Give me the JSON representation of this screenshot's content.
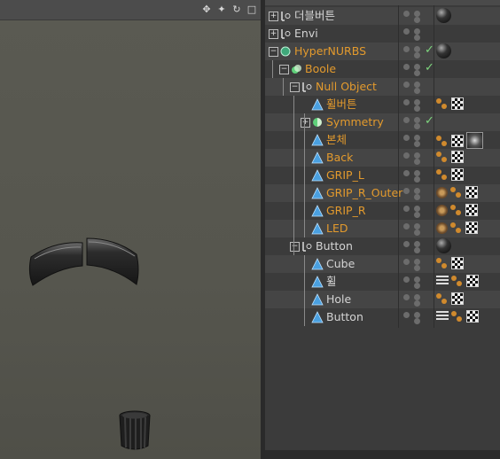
{
  "viewport": {
    "icons": [
      "move-icon",
      "pan-icon",
      "rotate-icon",
      "maximize-icon"
    ],
    "icon_glyphs": [
      "✥",
      "✦",
      "↻",
      "□"
    ]
  },
  "object_manager": {
    "rows": [
      {
        "label": "더블버튼",
        "color": "white",
        "indent": 0,
        "expander": "+",
        "icon": "null-icon",
        "tags": [
          "ball"
        ]
      },
      {
        "label": "Envi",
        "color": "white",
        "indent": 0,
        "expander": "+",
        "icon": "null-icon",
        "tags": []
      },
      {
        "label": "HyperNURBS",
        "color": "orange",
        "indent": 0,
        "expander": "-",
        "icon": "hypernurbs-icon",
        "check": true,
        "tags": [
          "ball"
        ]
      },
      {
        "label": "Boole",
        "color": "orange",
        "indent": 1,
        "expander": "-",
        "icon": "boole-icon",
        "check": true,
        "tags": []
      },
      {
        "label": "Null Object",
        "color": "orange",
        "indent": 2,
        "expander": "-",
        "icon": "null-icon",
        "tags": []
      },
      {
        "label": "휠버튼",
        "color": "orange",
        "indent": 3,
        "icon": "polygon-icon",
        "tags": [
          "dots",
          "check"
        ]
      },
      {
        "label": "Symmetry",
        "color": "orange",
        "indent": 3,
        "expander": "+",
        "icon": "symmetry-icon",
        "check": true,
        "tags": []
      },
      {
        "label": "본체",
        "color": "orange",
        "indent": 3,
        "icon": "polygon-icon",
        "tags": [
          "dots",
          "check",
          "metal"
        ]
      },
      {
        "label": "Back",
        "color": "orange",
        "indent": 3,
        "icon": "polygon-icon",
        "tags": [
          "dots",
          "check"
        ]
      },
      {
        "label": "GRIP_L",
        "color": "orange",
        "indent": 3,
        "icon": "polygon-icon",
        "tags": [
          "dots",
          "check"
        ]
      },
      {
        "label": "GRIP_R_Outer",
        "color": "orange",
        "indent": 3,
        "icon": "polygon-icon",
        "tags": [
          "gear",
          "dots",
          "check"
        ]
      },
      {
        "label": "GRIP_R",
        "color": "orange",
        "indent": 3,
        "icon": "polygon-icon",
        "tags": [
          "gear",
          "dots",
          "check"
        ]
      },
      {
        "label": "LED",
        "color": "orange",
        "indent": 3,
        "icon": "polygon-icon",
        "tags": [
          "gear",
          "dots",
          "check"
        ]
      },
      {
        "label": "Button",
        "color": "white",
        "indent": 2,
        "expander": "-",
        "icon": "null-icon",
        "tags": [
          "ball"
        ]
      },
      {
        "label": "Cube",
        "color": "white",
        "indent": 3,
        "icon": "polygon-icon",
        "tags": [
          "dots",
          "check"
        ]
      },
      {
        "label": "휠",
        "color": "white",
        "indent": 3,
        "icon": "polygon-icon",
        "tags": [
          "lines",
          "dots",
          "check"
        ]
      },
      {
        "label": "Hole",
        "color": "white",
        "indent": 3,
        "icon": "polygon-icon",
        "tags": [
          "dots",
          "check"
        ]
      },
      {
        "label": "Button",
        "color": "white",
        "indent": 3,
        "icon": "polygon-icon",
        "tags": [
          "lines",
          "dots",
          "check"
        ]
      }
    ]
  },
  "colors": {
    "orange_text": "#e39a2d",
    "white_text": "#d4d4d4",
    "check": "#7ed67e"
  }
}
